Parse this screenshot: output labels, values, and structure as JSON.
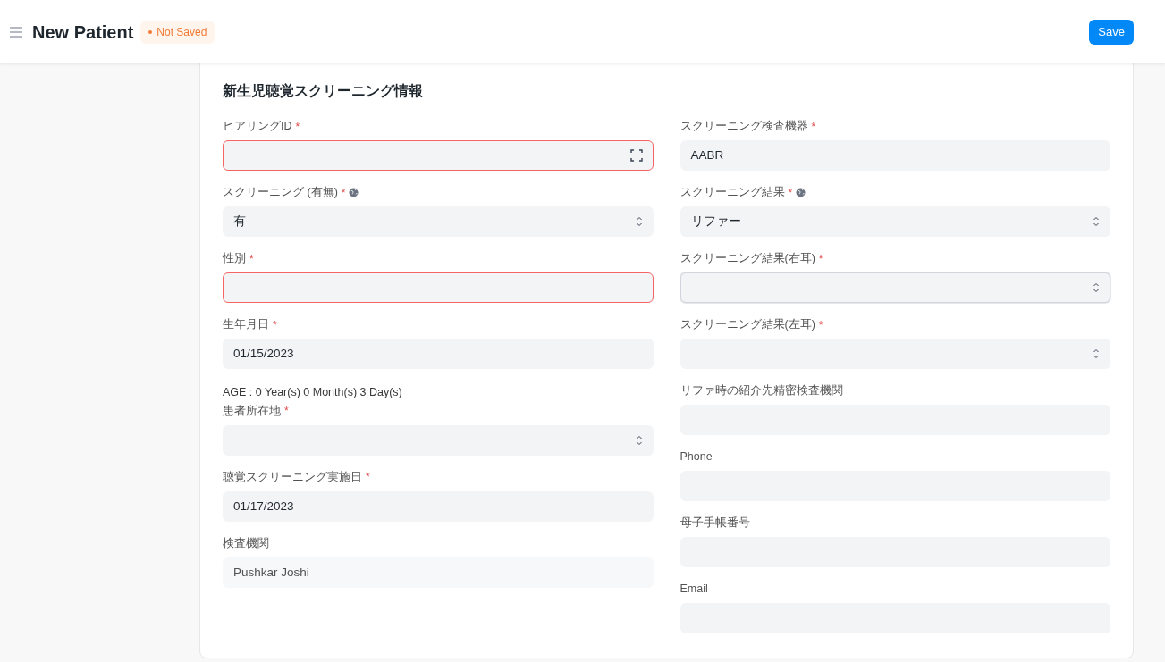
{
  "header": {
    "title": "New Patient",
    "status": "Not Saved",
    "save_button": "Save"
  },
  "section": {
    "title": "新生児聴覚スクリーニング情報"
  },
  "left_column": [
    {
      "kind": "scan",
      "label": "ヒアリングID",
      "required_mark": "*",
      "globe": false,
      "error": true,
      "focused": false
    },
    {
      "kind": "select",
      "label": "スクリーニング (有無)",
      "required_mark": "*",
      "globe": true,
      "value": "有",
      "error": false,
      "focused": false
    },
    {
      "kind": "input",
      "label": "性別",
      "required_mark": "*",
      "globe": false,
      "error": true,
      "focused": false
    },
    {
      "kind": "input",
      "label": "生年月日",
      "required_mark": "*",
      "globe": false,
      "value": "01/15/2023",
      "error": false,
      "focused": false,
      "note": "AGE : 0 Year(s) 0 Month(s) 3 Day(s)"
    },
    {
      "kind": "select",
      "label": "患者所在地",
      "required_mark": "*",
      "globe": false,
      "error": false,
      "focused": false
    },
    {
      "kind": "input",
      "label": "聴覚スクリーニング実施日",
      "required_mark": "*",
      "globe": false,
      "value": "01/17/2023",
      "error": false,
      "focused": false
    },
    {
      "kind": "readonly",
      "label": "検査機関",
      "globe": false,
      "value": "Pushkar Joshi",
      "error": false,
      "focused": false
    }
  ],
  "right_column": [
    {
      "kind": "input",
      "label": "スクリーニング検査機器",
      "required_mark": "*",
      "globe": false,
      "value": "AABR",
      "error": false,
      "focused": false
    },
    {
      "kind": "select",
      "label": "スクリーニング結果",
      "required_mark": "*",
      "globe": true,
      "value": "リファー",
      "error": false,
      "focused": false
    },
    {
      "kind": "select",
      "label": "スクリーニング結果(右耳)",
      "required_mark": "*",
      "globe": false,
      "error": false,
      "focused": true
    },
    {
      "kind": "select",
      "label": "スクリーニング結果(左耳)",
      "required_mark": "*",
      "globe": false,
      "error": false,
      "focused": false
    },
    {
      "kind": "input",
      "label": "リファ時の紹介先精密検査機関",
      "globe": false,
      "error": false,
      "focused": false
    },
    {
      "kind": "input",
      "label": "Phone",
      "globe": false,
      "error": false,
      "focused": false
    },
    {
      "kind": "input",
      "label": "母子手帳番号",
      "globe": false,
      "error": false,
      "focused": false
    },
    {
      "kind": "input",
      "label": "Email",
      "globe": false,
      "error": false,
      "focused": false
    }
  ]
}
